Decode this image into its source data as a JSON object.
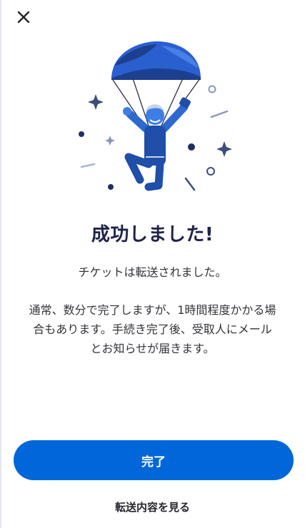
{
  "header": {
    "close_icon": "close-icon"
  },
  "illustration": {
    "icon": "parachute-person-illustration",
    "colors": {
      "canopy": "#2a5fd0",
      "canopy_dark": "#1d3f8f",
      "body": "#1f4fa8",
      "limb": "#2e69cf",
      "skin": "#3d7ee6",
      "hair": "#c9d2e6",
      "sparkle": "#3c4f7c",
      "line_light": "#a9b4cf"
    }
  },
  "content": {
    "title": "成功しました!",
    "subtitle": "チケットは転送されました。",
    "body_lines": [
      "通常、数分で完了しますが、1時間程度かかる場",
      "合もあります。手続き完了後、受取人にメール",
      "とお知らせが届きます。"
    ]
  },
  "actions": {
    "done_label": "完了",
    "view_transfer_label": "転送内容を見る"
  },
  "colors": {
    "primary": "#0066d9",
    "title": "#1f2448",
    "text": "#33333b"
  }
}
